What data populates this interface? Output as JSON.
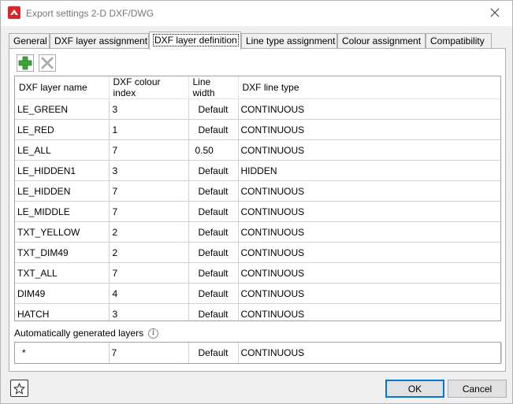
{
  "window": {
    "title": "Export settings 2-D DXF/DWG"
  },
  "tabs": [
    {
      "label": "General",
      "active": false
    },
    {
      "label": "DXF layer assignment",
      "active": false
    },
    {
      "label": "DXF layer definition",
      "active": true
    },
    {
      "label": "Line type assignment",
      "active": false
    },
    {
      "label": "Colour assignment",
      "active": false
    },
    {
      "label": "Compatibility",
      "active": false
    }
  ],
  "toolbar": {
    "add_icon": "plus-icon",
    "delete_icon": "x-icon"
  },
  "columns": [
    "DXF layer name",
    "DXF colour index",
    "Line width",
    "DXF line type"
  ],
  "rows": [
    {
      "name": "LE_GREEN",
      "index": "3",
      "width": "Default",
      "type": "CONTINUOUS"
    },
    {
      "name": "LE_RED",
      "index": "1",
      "width": "Default",
      "type": "CONTINUOUS"
    },
    {
      "name": "LE_ALL",
      "index": "7",
      "width": "0.50",
      "type": "CONTINUOUS"
    },
    {
      "name": "LE_HIDDEN1",
      "index": "3",
      "width": "Default",
      "type": "HIDDEN"
    },
    {
      "name": "LE_HIDDEN",
      "index": "7",
      "width": "Default",
      "type": "CONTINUOUS"
    },
    {
      "name": "LE_MIDDLE",
      "index": "7",
      "width": "Default",
      "type": "CONTINUOUS"
    },
    {
      "name": "TXT_YELLOW",
      "index": "2",
      "width": "Default",
      "type": "CONTINUOUS"
    },
    {
      "name": "TXT_DIM49",
      "index": "2",
      "width": "Default",
      "type": "CONTINUOUS"
    },
    {
      "name": "TXT_ALL",
      "index": "7",
      "width": "Default",
      "type": "CONTINUOUS"
    },
    {
      "name": "DIM49",
      "index": "4",
      "width": "Default",
      "type": "CONTINUOUS"
    },
    {
      "name": "HATCH",
      "index": "3",
      "width": "Default",
      "type": "CONTINUOUS"
    }
  ],
  "auto_layers": {
    "label": "Automatically generated layers",
    "row": {
      "name": "*",
      "index": "7",
      "width": "Default",
      "type": "CONTINUOUS"
    }
  },
  "buttons": {
    "ok": "OK",
    "cancel": "Cancel"
  },
  "colors": {
    "add_green": "#3aa63a",
    "accent": "#0078d7",
    "app_red": "#d9262b"
  }
}
